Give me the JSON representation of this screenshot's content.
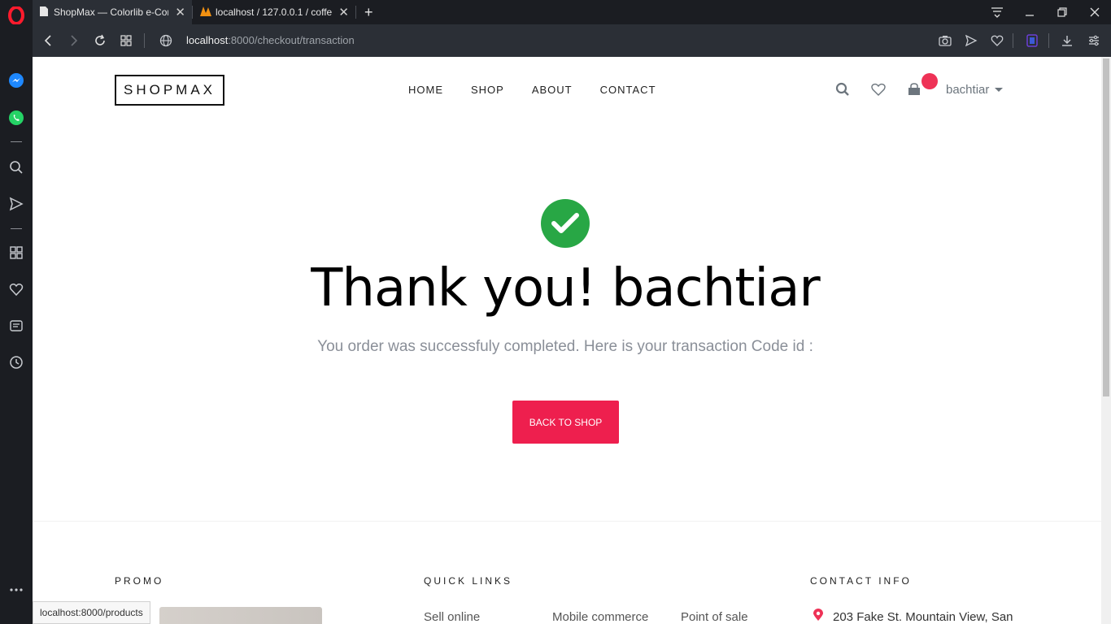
{
  "browser": {
    "tabs": [
      {
        "title": "ShopMax — Colorlib e-Cor",
        "active": true
      },
      {
        "title": "localhost / 127.0.0.1 / coffe",
        "active": false
      }
    ],
    "url_host": "localhost",
    "url_path": ":8000/checkout/transaction",
    "status_tooltip": "localhost:8000/products"
  },
  "header": {
    "logo": "SHOPMAX",
    "nav": [
      "HOME",
      "SHOP",
      "ABOUT",
      "CONTACT"
    ],
    "user": "bachtiar"
  },
  "main": {
    "title": "Thank you! bachtiar",
    "subtitle": "You order was successfuly completed. Here is your transaction Code id :",
    "button": "BACK TO SHOP"
  },
  "footer": {
    "promo_heading": "PROMO",
    "quick_links_heading": "QUICK LINKS",
    "contact_heading": "CONTACT INFO",
    "quick_links": [
      "Sell online",
      "Mobile commerce",
      "Point of sale"
    ],
    "address": "203 Fake St. Mountain View, San"
  },
  "colors": {
    "accent": "#ee1f4e",
    "success": "#28a745"
  }
}
